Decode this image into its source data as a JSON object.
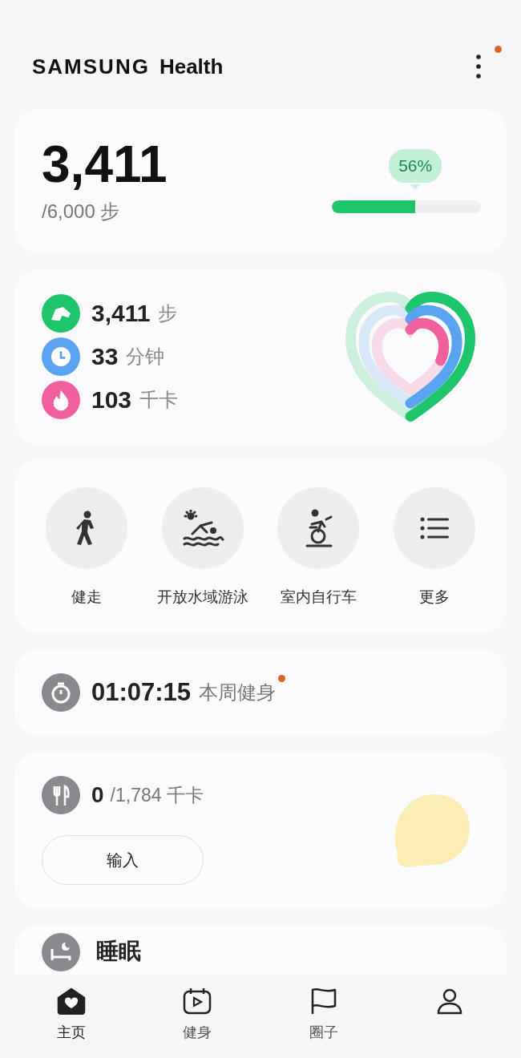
{
  "header": {
    "brand": "SAMSUNG",
    "app": "Health",
    "menu_notification": true
  },
  "steps": {
    "count": "3,411",
    "goal": "/6,000 步",
    "level": 0.56,
    "percent": "56%"
  },
  "activity": {
    "rows": [
      {
        "kind": "steps",
        "value": "3,411",
        "unit": "步",
        "color": "#1ec66b"
      },
      {
        "kind": "time",
        "value": "33",
        "unit": "分钟",
        "color": "#5aa3f0"
      },
      {
        "kind": "calories",
        "value": "103",
        "unit": "千卡",
        "color": "#f0609e"
      }
    ]
  },
  "workouts": [
    {
      "kind": "walk",
      "label": "健走"
    },
    {
      "kind": "swim",
      "label": "开放水域游泳"
    },
    {
      "kind": "bike",
      "label": "室内自行车"
    },
    {
      "kind": "more",
      "label": "更多"
    }
  ],
  "weekly": {
    "time": "01:07:15",
    "label": "本周健身",
    "notification": true
  },
  "food": {
    "value": "0",
    "target": "/1,784 千卡",
    "button": "输入"
  },
  "sleep": {
    "title": "睡眠"
  },
  "nav": [
    {
      "kind": "home",
      "label": "主页",
      "selected": true
    },
    {
      "kind": "fitness",
      "label": "健身",
      "selected": false
    },
    {
      "kind": "together",
      "label": "圈子",
      "selected": false
    },
    {
      "kind": "profile",
      "selected": false
    }
  ]
}
